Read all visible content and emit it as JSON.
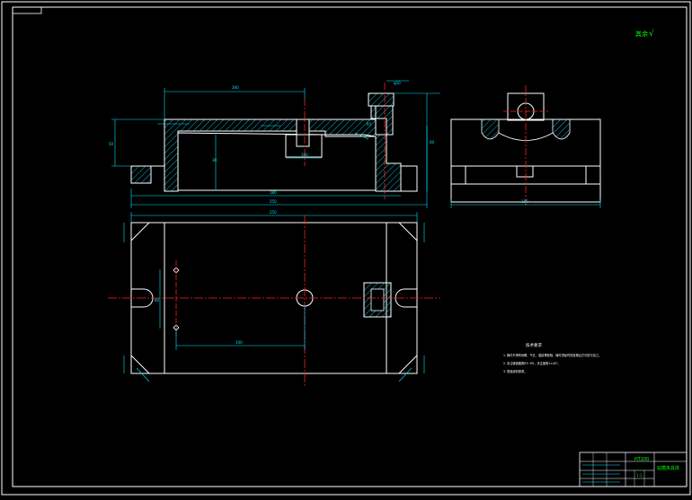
{
  "drawing": {
    "roughness_note": "其余",
    "roughness_symbol": "√",
    "technical_requirements": {
      "title": "技术要求",
      "items": [
        "1. 铸件不得有砂眼、气孔、裂纹等缺陷，铸件须经时效处理后方可进行加工。",
        "2. 未注铸造圆角R3~R5，未注倒角1×45°。",
        "3. 表面涂防锈漆。"
      ]
    },
    "title_block": {
      "drawing_name": "钻模夹具体",
      "material": "HT200",
      "scale": "1:1"
    },
    "colors": {
      "background": "#000000",
      "outline": "#ffffff",
      "dimension": "#00e5ff",
      "centerline": "#ff2020",
      "hatch": "#00e5ff",
      "annotation": "#00ff00",
      "title_text": "#00ff00"
    }
  }
}
